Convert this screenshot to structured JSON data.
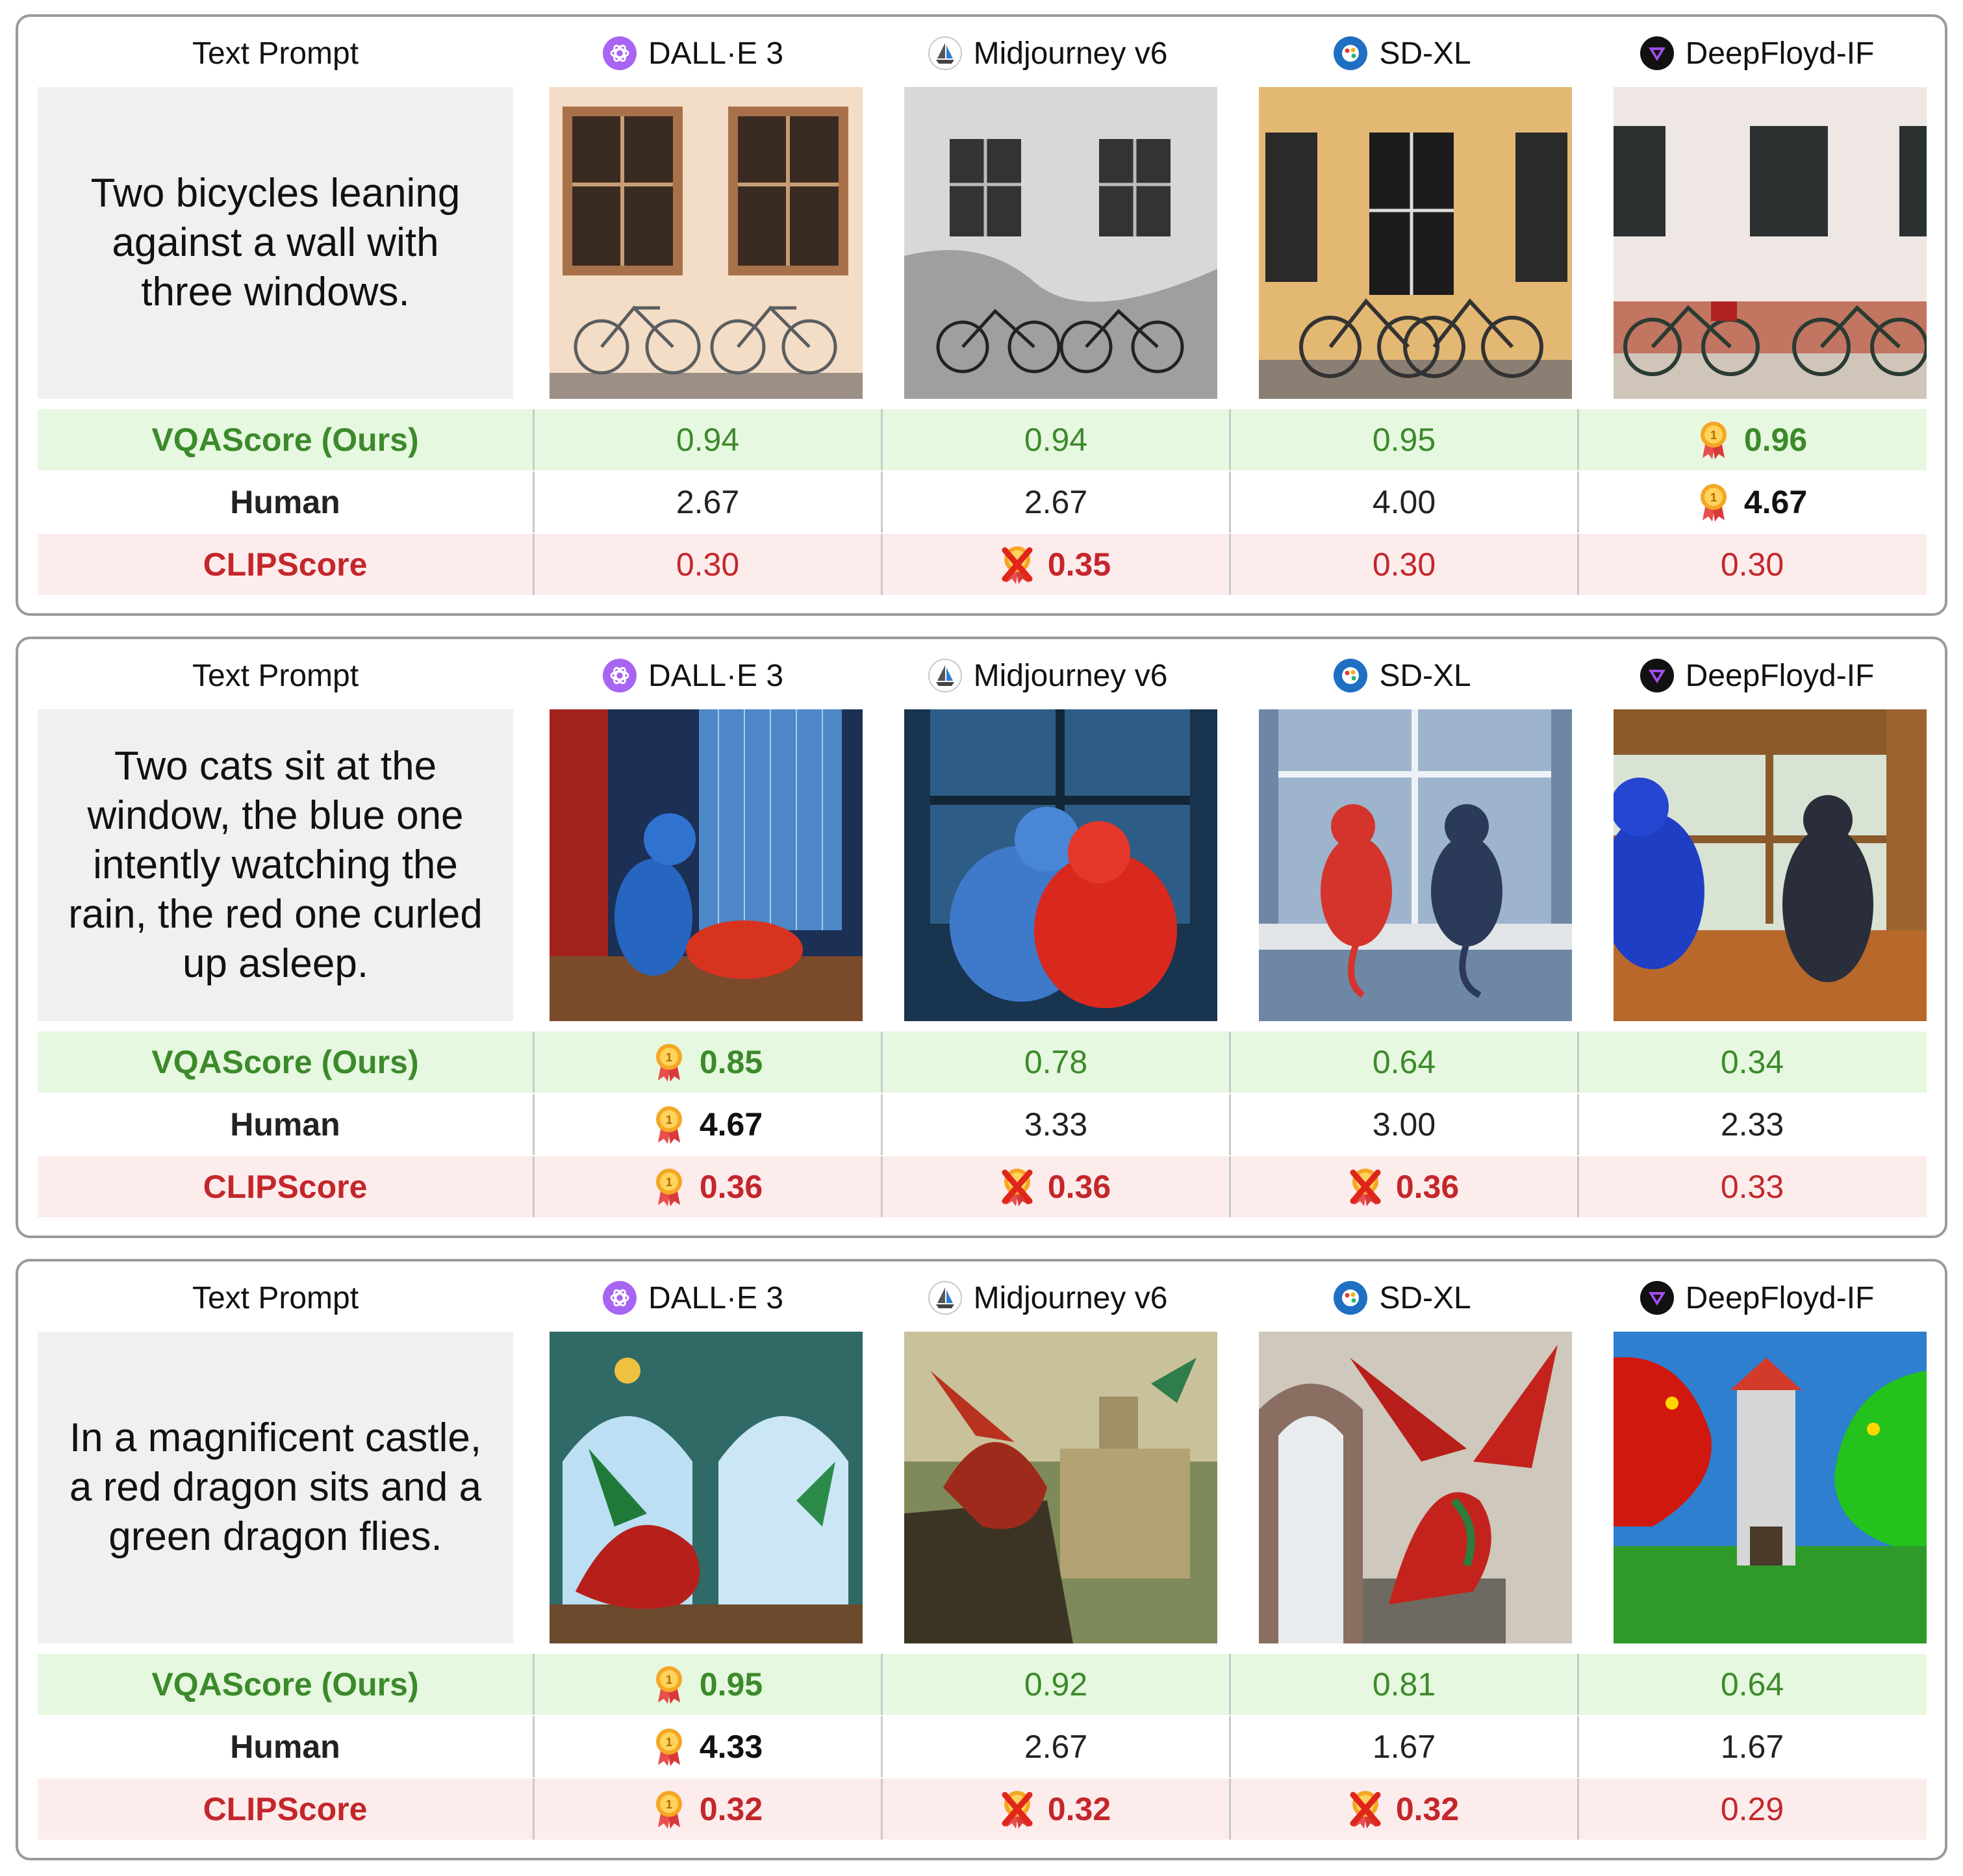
{
  "header_label": "Text Prompt",
  "models": [
    {
      "name": "DALL·E 3",
      "icon": "openai-logo-icon"
    },
    {
      "name": "Midjourney v6",
      "icon": "midjourney-logo-icon"
    },
    {
      "name": "SD-XL",
      "icon": "stability-logo-icon"
    },
    {
      "name": "DeepFloyd-IF",
      "icon": "deepfloyd-logo-icon"
    }
  ],
  "row_labels": {
    "vqa": "VQAScore (Ours)",
    "human": "Human",
    "clip": "CLIPScore"
  },
  "colors": {
    "vqa_text": "#3c8a2b",
    "vqa_bg": "#e6f8df",
    "clip_text": "#c3272b",
    "clip_bg": "#fdecec",
    "prompt_bg": "#f0f0f0"
  },
  "panels": [
    {
      "prompt": "Two bicycles leaning against a wall with three windows.",
      "image_descriptions": [
        "DALL·E 3 bicycles image",
        "Midjourney bicycles image",
        "SD-XL bicycles image",
        "DeepFloyd bicycles image"
      ],
      "vqa": [
        "0.94",
        "0.94",
        "0.95",
        "0.96"
      ],
      "human": [
        "2.67",
        "2.67",
        "4.00",
        "4.67"
      ],
      "clip": [
        "0.30",
        "0.35",
        "0.30",
        "0.30"
      ],
      "vqa_marks": [
        "",
        "",
        "",
        "medal"
      ],
      "human_marks": [
        "",
        "",
        "",
        "medal"
      ],
      "clip_marks": [
        "",
        "cross",
        "",
        ""
      ]
    },
    {
      "prompt": "Two cats sit at the window, the blue one intently watching the rain, the red one curled up asleep.",
      "image_descriptions": [
        "DALL·E 3 cats image",
        "Midjourney cats image",
        "SD-XL cats image",
        "DeepFloyd cats image"
      ],
      "vqa": [
        "0.85",
        "0.78",
        "0.64",
        "0.34"
      ],
      "human": [
        "4.67",
        "3.33",
        "3.00",
        "2.33"
      ],
      "clip": [
        "0.36",
        "0.36",
        "0.36",
        "0.33"
      ],
      "vqa_marks": [
        "medal",
        "",
        "",
        ""
      ],
      "human_marks": [
        "medal",
        "",
        "",
        ""
      ],
      "clip_marks": [
        "medal",
        "cross",
        "cross",
        ""
      ]
    },
    {
      "prompt": "In a magnificent castle, a red dragon sits and a green dragon flies.",
      "image_descriptions": [
        "DALL·E 3 dragons image",
        "Midjourney dragons image",
        "SD-XL dragons image",
        "DeepFloyd dragons image"
      ],
      "vqa": [
        "0.95",
        "0.92",
        "0.81",
        "0.64"
      ],
      "human": [
        "4.33",
        "2.67",
        "1.67",
        "1.67"
      ],
      "clip": [
        "0.32",
        "0.32",
        "0.32",
        "0.29"
      ],
      "vqa_marks": [
        "medal",
        "",
        "",
        ""
      ],
      "human_marks": [
        "medal",
        "",
        "",
        ""
      ],
      "clip_marks": [
        "medal",
        "cross",
        "cross",
        ""
      ]
    }
  ]
}
